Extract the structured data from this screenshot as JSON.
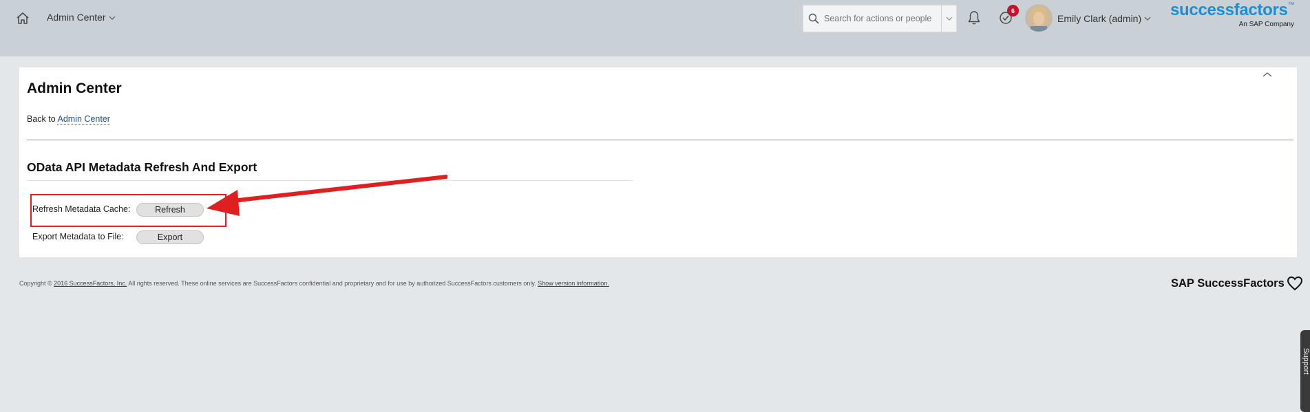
{
  "header": {
    "nav_title": "Admin Center",
    "search_placeholder": "Search for actions or people",
    "notification_count": "6",
    "user_name": "Emily Clark (admin)",
    "logo_text": "successfactors",
    "logo_tm": "™",
    "logo_sub": "An SAP Company",
    "brand_color": "#1a8fd6",
    "icons": [
      "home-icon",
      "chevron-down-icon",
      "search-icon",
      "bell-icon",
      "todo-check-icon"
    ]
  },
  "main": {
    "page_title": "Admin Center",
    "back_prefix": "Back to ",
    "back_link": "Admin Center",
    "section_title": "OData API Metadata Refresh And Export",
    "rows": [
      {
        "label": "Refresh Metadata Cache:",
        "button": "Refresh"
      },
      {
        "label": "Export Metadata to File:",
        "button": "Export"
      }
    ],
    "annotation_color": "#e02020"
  },
  "footer": {
    "copyright_prefix": "Copyright © ",
    "copyright_link": "2016 SuccessFactors, Inc.",
    "copyright_text": " All rights reserved. These online services are SuccessFactors confidential and proprietary and for use by authorized SuccessFactors customers only. ",
    "version_link": "Show version information.",
    "brand": "SAP SuccessFactors",
    "support_tab": "Support"
  }
}
